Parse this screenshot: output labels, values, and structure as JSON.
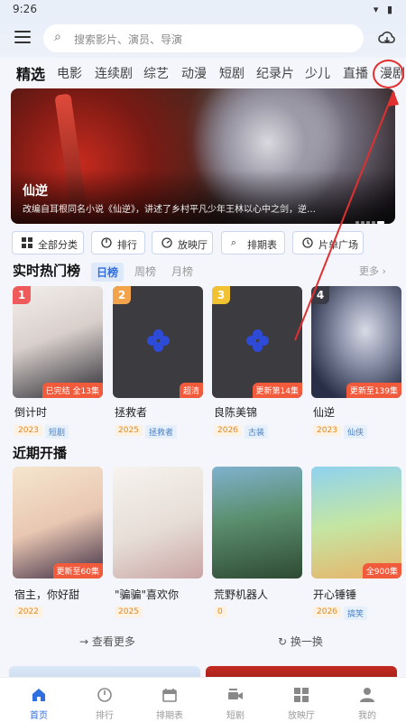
{
  "status": {
    "time": "9:26"
  },
  "search": {
    "placeholder": "搜索影片、演员、导演"
  },
  "categories": [
    "精选",
    "电影",
    "连续剧",
    "综艺",
    "动漫",
    "短剧",
    "纪录片",
    "少儿",
    "直播",
    "漫剧"
  ],
  "banner": {
    "title": "仙逆",
    "description": "改编自耳根同名小说《仙逆》，讲述了乡村平凡少年王林以心中之剑，逆…",
    "slide_count": 5,
    "active_slide": 1
  },
  "quick": [
    "全部分类",
    "排行",
    "放映厅",
    "排期表",
    "片单广场"
  ],
  "hot": {
    "title": "实时热门榜",
    "tabs": [
      "日榜",
      "周榜",
      "月榜"
    ],
    "more": "更多 ›",
    "items": [
      {
        "rank": "1",
        "name": "倒计时",
        "badge": "已完结 全13集",
        "year": "2023",
        "genre": "短剧"
      },
      {
        "rank": "2",
        "name": "拯救者",
        "badge": "超清",
        "year": "2025",
        "genre": "拯救者"
      },
      {
        "rank": "3",
        "name": "良陈美锦",
        "badge": "更新第14集",
        "year": "2026",
        "genre": "古装"
      },
      {
        "rank": "4",
        "name": "仙逆",
        "badge": "更新至139集",
        "year": "2023",
        "genre": "仙侠"
      }
    ]
  },
  "upcoming": {
    "title": "近期开播",
    "items": [
      {
        "name": "宿主，你好甜",
        "badge": "更新至60集",
        "year": "2022",
        "genre": ""
      },
      {
        "name": "\"骗骗\"喜欢你",
        "badge": "",
        "year": "2025",
        "genre": ""
      },
      {
        "name": "荒野机器人",
        "badge": "",
        "year": "0",
        "genre": ""
      },
      {
        "name": "开心锤锤",
        "badge": "全900集",
        "year": "2026",
        "genre": "搞笑"
      }
    ],
    "see_more": "查看更多",
    "shuffle": "换一换"
  },
  "nav": [
    {
      "label": "首页",
      "icon": "home-icon"
    },
    {
      "label": "排行",
      "icon": "rank-icon"
    },
    {
      "label": "排期表",
      "icon": "calendar-icon"
    },
    {
      "label": "短剧",
      "icon": "video-icon"
    },
    {
      "label": "放映厅",
      "icon": "grid-icon"
    },
    {
      "label": "我的",
      "icon": "user-icon"
    }
  ],
  "colors": {
    "accent": "#2f6fe0",
    "badge": "#f25a3c",
    "annotation": "#e03030"
  }
}
